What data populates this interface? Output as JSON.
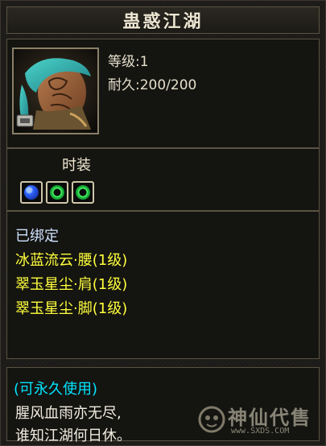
{
  "window": {
    "title": "蛊惑江湖"
  },
  "item": {
    "level_text": "等级:1",
    "durability_text": "耐久:200/200"
  },
  "fashion": {
    "label": "时装",
    "sockets": [
      {
        "icon": "blue-gem-icon",
        "color": "#2f63ff"
      },
      {
        "icon": "green-gem-icon",
        "color": "#19b23a"
      },
      {
        "icon": "green-gem-icon",
        "color": "#19b23a"
      }
    ]
  },
  "attributes": {
    "bound_text": "已绑定",
    "bound_color": "#cfe3ff",
    "lines": [
      {
        "text": "冰蓝流云·腰(1级)",
        "color": "#ffff3d"
      },
      {
        "text": "翠玉星尘·肩(1级)",
        "color": "#ffff3d"
      },
      {
        "text": "翠玉星尘·脚(1级)",
        "color": "#ffff3d"
      }
    ]
  },
  "description": {
    "permanent_text": "(可永久使用)",
    "permanent_color": "#00e5ff",
    "lines": [
      "腥风血雨亦无尽,",
      "谁知江湖何日休。"
    ]
  },
  "watermark": {
    "text": "神仙代售",
    "subtext": "www.SXDS.COM"
  }
}
